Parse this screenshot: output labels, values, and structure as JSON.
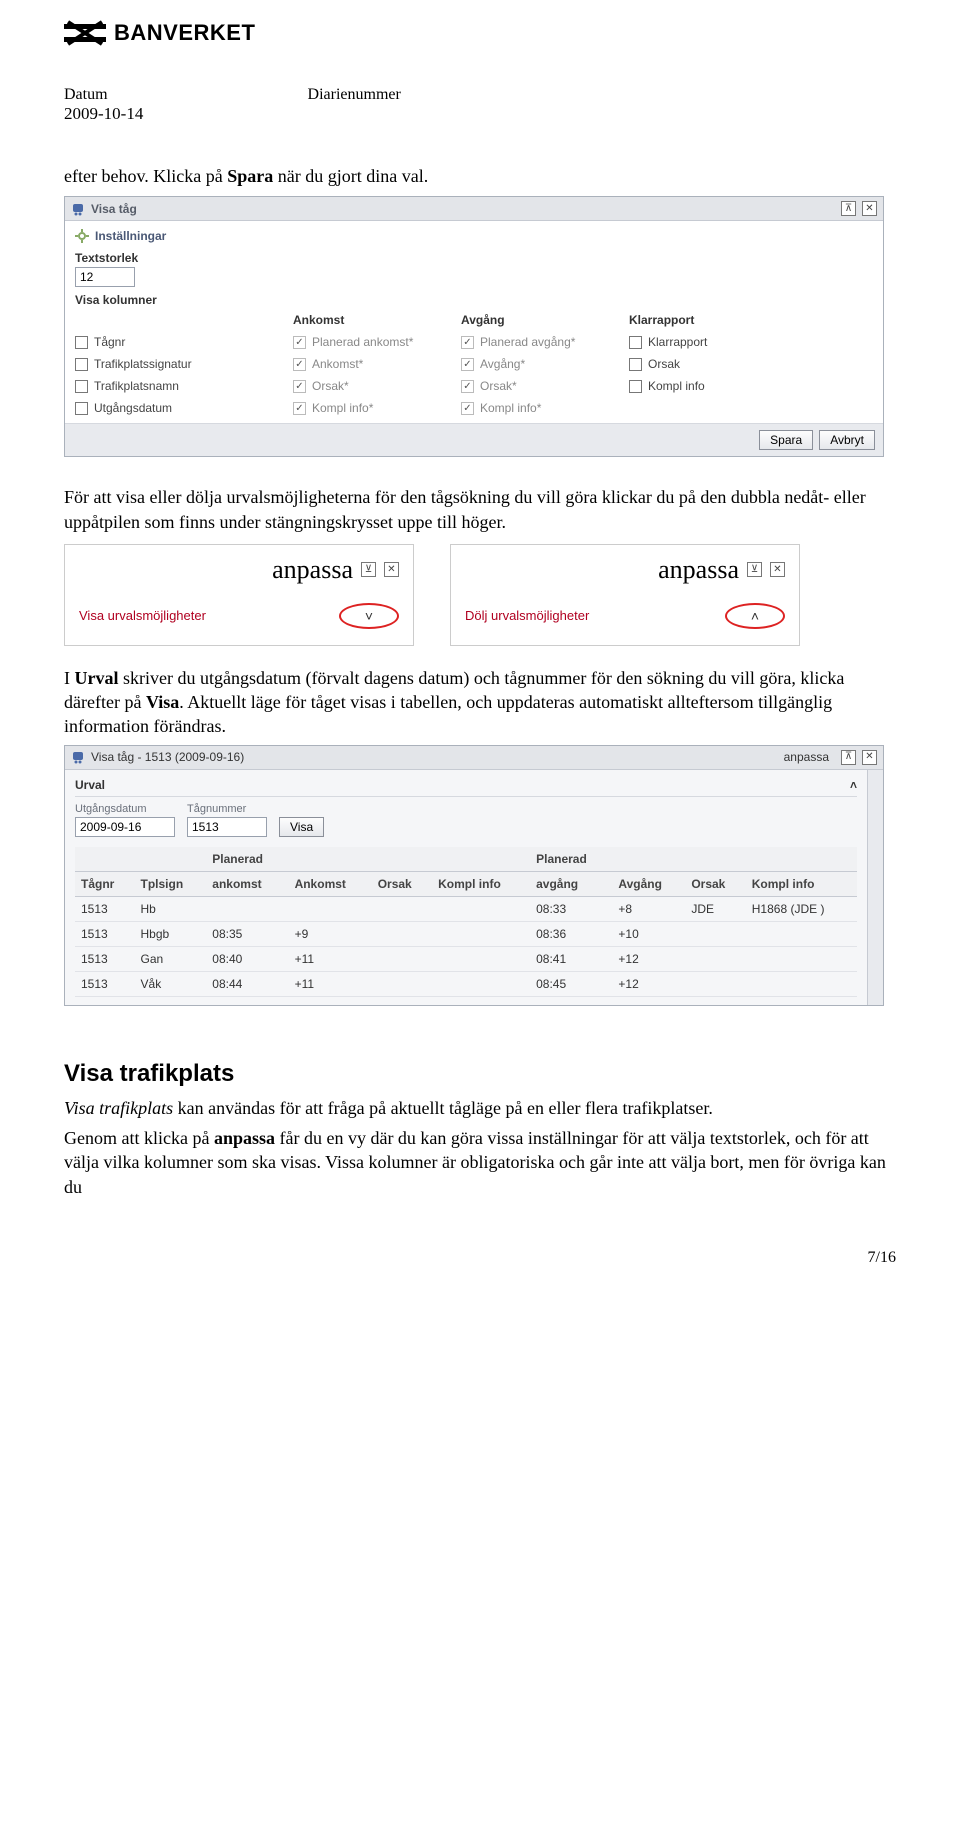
{
  "logo_text": "BANVERKET",
  "meta": {
    "label_date": "Datum",
    "label_diary": "Diarienummer",
    "date": "2009-10-14"
  },
  "p1_pre": "efter behov. Klicka på ",
  "p1_bold": "Spara",
  "p1_post": " när du gjort dina val.",
  "panel1": {
    "title": "Visa tåg",
    "section_title": "Inställningar",
    "lbl_textsize": "Textstorlek",
    "textsize_value": "12",
    "lbl_visa_kol": "Visa kolumner",
    "col_heads": [
      "",
      "Ankomst",
      "Avgång",
      "Klarrapport"
    ],
    "rows": [
      [
        "Tågnr",
        "Planerad ankomst*",
        "Planerad avgång*",
        "Klarrapport"
      ],
      [
        "Trafikplatssignatur",
        "Ankomst*",
        "Avgång*",
        "Orsak"
      ],
      [
        "Trafikplatsnamn",
        "Orsak*",
        "Orsak*",
        "Kompl info"
      ],
      [
        "Utgångsdatum",
        "Kompl info*",
        "Kompl info*",
        ""
      ]
    ],
    "btn_save": "Spara",
    "btn_cancel": "Avbryt"
  },
  "p2": "För att visa eller dölja urvalsmöjligheterna för den tågsökning du vill göra klickar du på den dubbla nedåt- eller uppåtpilen som finns under stängningskrysset uppe till höger.",
  "pair": {
    "anpassa": "anpassa",
    "left_label": "Visa urvalsmöjligheter",
    "right_label": "Dölj urvalsmöjligheter",
    "chev_down": "˅",
    "chev_up": "˄"
  },
  "p3_parts": {
    "a": "I ",
    "b": "Urval",
    "c": " skriver du utgångsdatum (förvalt dagens datum) och tågnummer för den sökning du vill göra, klicka därefter på ",
    "d": "Visa",
    "e": ". Aktuellt läge för tåget visas i tabellen, och uppdateras automatiskt allteftersom tillgänglig information förändras."
  },
  "panel2": {
    "title": "Visa tåg - 1513 (2009-09-16)",
    "anpassa": "anpassa",
    "urval_title": "Urval",
    "lbl_date": "Utgångsdatum",
    "lbl_train": "Tågnummer",
    "date_value": "2009-09-16",
    "train_value": "1513",
    "btn_visa": "Visa"
  },
  "chart_data": {
    "type": "table",
    "columns": [
      "Tågnr",
      "Tplsign",
      "Planerad ankomst",
      "Ankomst",
      "Orsak",
      "Kompl info",
      "Planerad avgång",
      "Avgång",
      "Orsak",
      "Kompl info"
    ],
    "rows": [
      [
        "1513",
        "Hb",
        "",
        "",
        "",
        "",
        "08:33",
        "+8",
        "JDE",
        "H1868 (JDE )"
      ],
      [
        "1513",
        "Hbgb",
        "08:35",
        "+9",
        "",
        "",
        "08:36",
        "+10",
        "",
        ""
      ],
      [
        "1513",
        "Gan",
        "08:40",
        "+11",
        "",
        "",
        "08:41",
        "+12",
        "",
        ""
      ],
      [
        "1513",
        "Våk",
        "08:44",
        "+11",
        "",
        "",
        "08:45",
        "+12",
        "",
        ""
      ]
    ]
  },
  "h2": "Visa trafikplats",
  "p4_parts": {
    "a": "Visa trafikplats",
    "b": " kan användas för att fråga på aktuellt tågläge på en eller flera trafikplatser."
  },
  "p5_parts": {
    "a": "Genom att klicka på ",
    "b": "anpassa",
    "c": " får du en vy där du kan göra vissa inställningar för att välja textstorlek, och för att välja vilka kolumner som ska visas. Vissa kolumner är obligatoriska och går inte att välja bort, men för övriga kan du"
  },
  "pagenum": "7/16"
}
